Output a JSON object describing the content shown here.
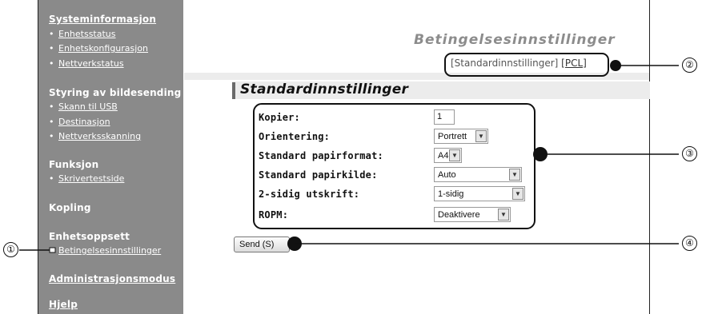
{
  "sidebar": {
    "sections": [
      {
        "label": "Systeminformasjon",
        "items": [
          "Enhetsstatus",
          "Enhetskonfigurasjon",
          "Nettverkstatus"
        ]
      },
      {
        "label": "Styring av bildesending",
        "items": [
          "Skann til USB",
          "Destinasjon",
          "Nettverksskanning"
        ]
      },
      {
        "label": "Funksjon",
        "items": [
          "Skrivertestside"
        ]
      },
      {
        "label": "Kopling",
        "items": []
      },
      {
        "label": "Enhetsoppsett",
        "items": [
          "Betingelsesinnstillinger"
        ]
      },
      {
        "label": "Administrasjonsmodus",
        "items": []
      },
      {
        "label": "Hjelp",
        "items": []
      }
    ]
  },
  "page": {
    "title": "Betingelsesinnstillinger",
    "link_standard": "[Standardinnstillinger]",
    "link_pcl": "[PCL]",
    "section_title": "Standardinnstillinger"
  },
  "form": {
    "copies": {
      "label": "Kopier:",
      "value": "1"
    },
    "orientation": {
      "label": "Orientering:",
      "value": "Portrett"
    },
    "paper_size": {
      "label": "Standard papirformat:",
      "value": "A4"
    },
    "paper_source": {
      "label": "Standard papirkilde:",
      "value": "Auto"
    },
    "duplex": {
      "label": "2-sidig utskrift:",
      "value": "1-sidig"
    },
    "ropm": {
      "label": "ROPM:",
      "value": "Deaktivere"
    },
    "submit_label": "Send (S)"
  },
  "callouts": [
    "①",
    "②",
    "③",
    "④"
  ]
}
